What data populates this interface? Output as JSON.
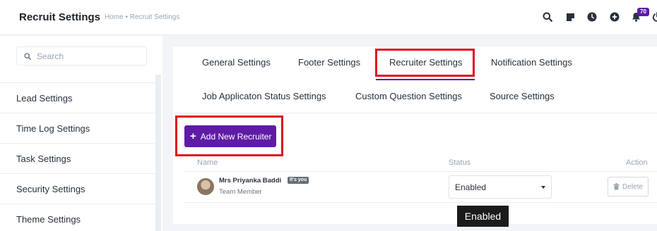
{
  "header": {
    "title": "Recruit Settings",
    "breadcrumb": "Home • Recruit Settings",
    "notification_count": "70"
  },
  "sidebar": {
    "search_placeholder": "Search",
    "items": [
      {
        "label": "Lead Settings"
      },
      {
        "label": "Time Log Settings"
      },
      {
        "label": "Task Settings"
      },
      {
        "label": "Security Settings"
      },
      {
        "label": "Theme Settings"
      }
    ]
  },
  "tabs": [
    {
      "label": "General Settings"
    },
    {
      "label": "Footer Settings"
    },
    {
      "label": "Recruiter Settings",
      "active": true
    },
    {
      "label": "Notification Settings"
    },
    {
      "label": "Job Applicaton Status Settings"
    },
    {
      "label": "Custom Question Settings"
    },
    {
      "label": "Source Settings"
    }
  ],
  "actions": {
    "add_button_label": "Add New Recruiter"
  },
  "table": {
    "columns": {
      "name": "Name",
      "status": "Status",
      "action": "Action"
    },
    "rows": [
      {
        "name": "Mrs Priyanka Baddi",
        "badge": "It's you",
        "role": "Team Member",
        "status": "Enabled",
        "action_label": "Delete"
      }
    ]
  },
  "tooltip": "Enabled",
  "colors": {
    "accent": "#5f1ba6",
    "highlight": "#e0101e"
  }
}
